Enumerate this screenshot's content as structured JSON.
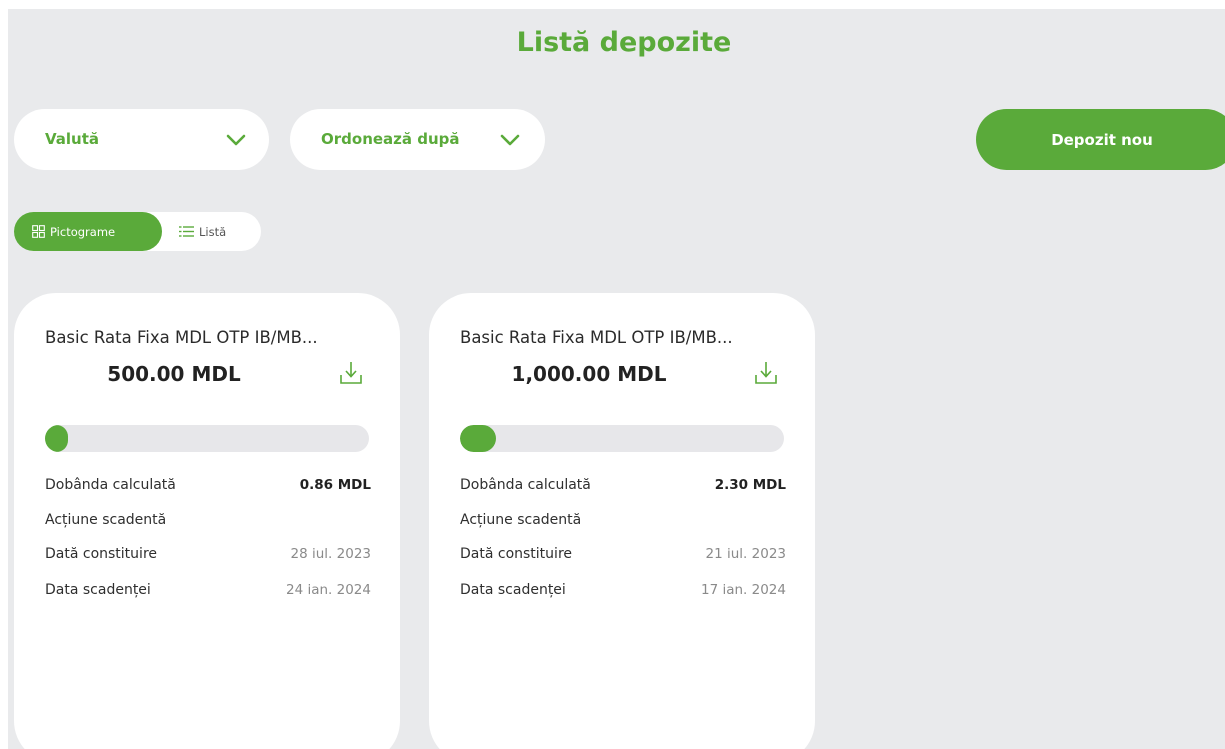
{
  "colors": {
    "accent": "#5aaa3a"
  },
  "page": {
    "title": "Listă depozite"
  },
  "filters": {
    "currency": {
      "label": "Valută",
      "icon": "chevron-down-icon"
    },
    "sort": {
      "label": "Ordonează după",
      "icon": "chevron-down-icon"
    }
  },
  "actions": {
    "new_deposit": "Depozit nou"
  },
  "view_toggle": {
    "tiles": {
      "label": "Pictograme",
      "icon": "grid-icon",
      "active": true
    },
    "list": {
      "label": "Listă",
      "icon": "list-icon",
      "active": false
    }
  },
  "cards": [
    {
      "name": "Basic Rata Fixa MDL OTP IB/MB...",
      "amount": "500.00 MDL",
      "progress": 0.07,
      "rows": [
        {
          "label": "Dobânda calculată",
          "value": "0.86 MDL"
        },
        {
          "label": "Acțiune scadentă",
          "value": ""
        },
        {
          "label": "Dată constituire",
          "value": "28 iul. 2023"
        },
        {
          "label": "Data scadenței",
          "value": "24 ian. 2024"
        }
      ]
    },
    {
      "name": "Basic Rata Fixa MDL OTP IB/MB...",
      "amount": "1,000.00 MDL",
      "progress": 0.11,
      "rows": [
        {
          "label": "Dobânda calculată",
          "value": "2.30 MDL"
        },
        {
          "label": "Acțiune scadentă",
          "value": ""
        },
        {
          "label": "Dată constituire",
          "value": "21 iul. 2023"
        },
        {
          "label": "Data scadenței",
          "value": "17 ian. 2024"
        }
      ]
    }
  ]
}
